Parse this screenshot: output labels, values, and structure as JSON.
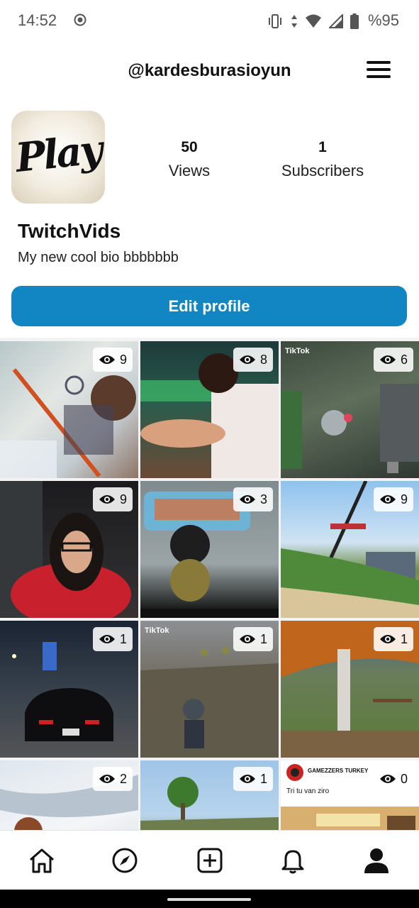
{
  "status_bar": {
    "time": "14:52",
    "battery": "%95"
  },
  "header": {
    "username": "@kardesburasioyun"
  },
  "profile": {
    "avatar_text": "Play",
    "views_count": "50",
    "views_label": "Views",
    "subscribers_count": "1",
    "subscribers_label": "Subscribers",
    "display_name": "TwitchVids",
    "bio": "My new cool bio bbbbbbb",
    "edit_button": "Edit profile"
  },
  "videos": [
    {
      "views": "9"
    },
    {
      "views": "8"
    },
    {
      "views": "6",
      "overlay": "TikTok"
    },
    {
      "views": "9"
    },
    {
      "views": "3"
    },
    {
      "views": "9"
    },
    {
      "views": "1"
    },
    {
      "views": "1",
      "overlay": "TikTok"
    },
    {
      "views": "1"
    },
    {
      "views": "2"
    },
    {
      "views": "1"
    },
    {
      "views": "0",
      "tweet_account": "GAMEZZERS TURKEY",
      "tweet_text": "Tri tu van ziro"
    }
  ],
  "nav": [
    "home-icon",
    "explore-icon",
    "create-icon",
    "notifications-icon",
    "profile-icon"
  ],
  "colors": {
    "accent": "#1286c3"
  }
}
